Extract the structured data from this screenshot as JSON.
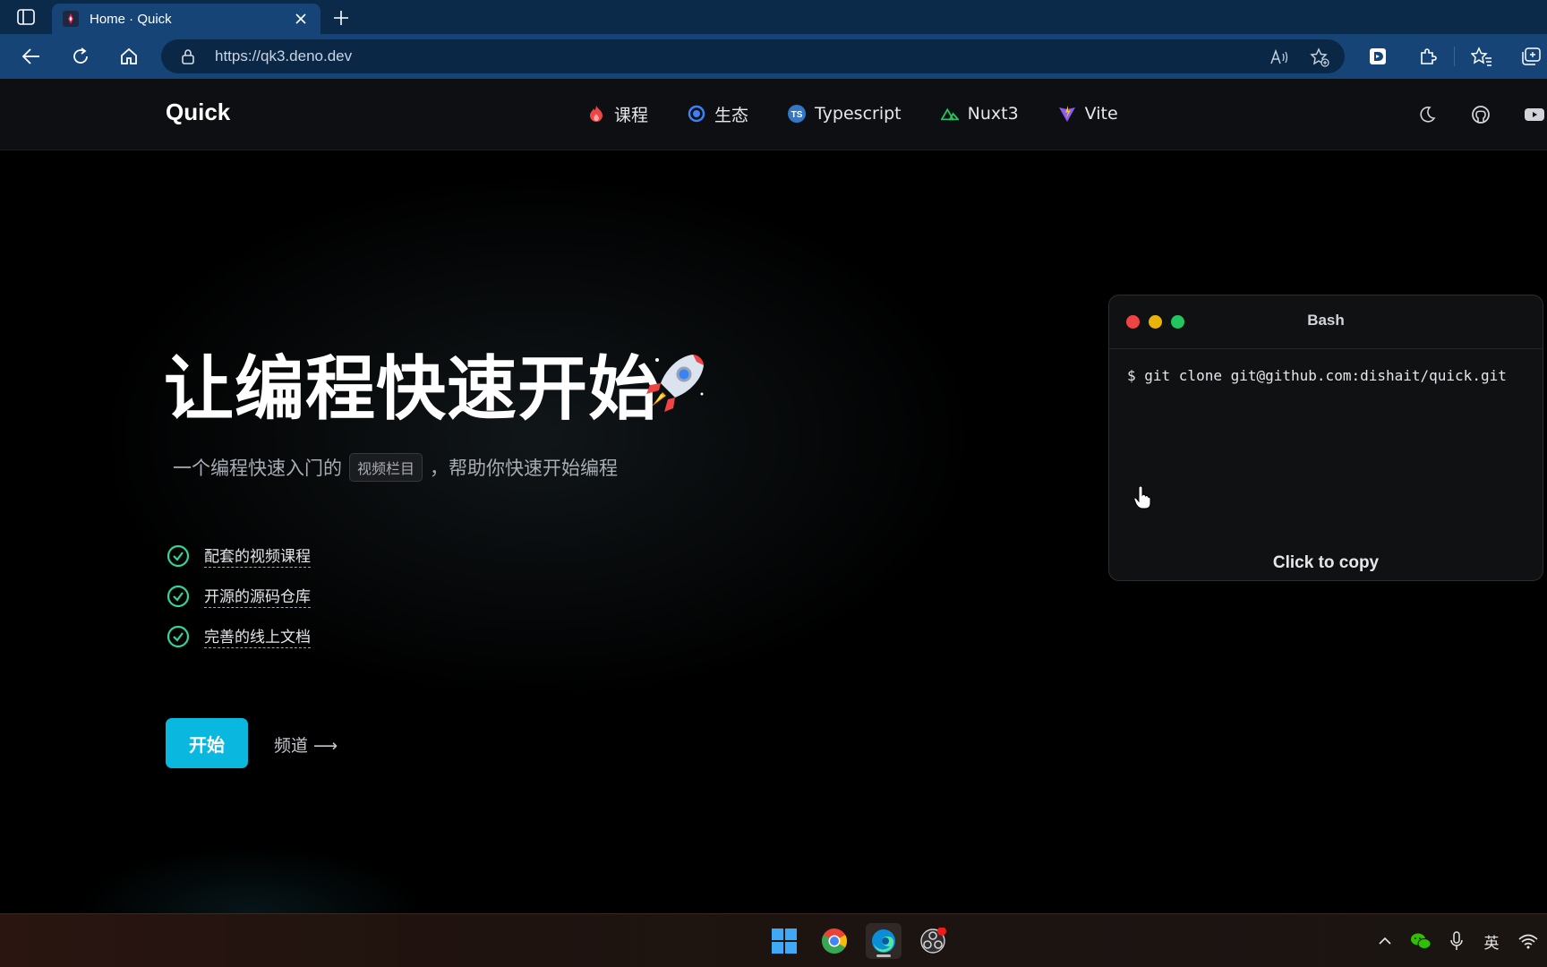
{
  "browser": {
    "tab_title": "Home · Quick",
    "url": "https://qk3.deno.dev"
  },
  "site": {
    "logo": "Quick",
    "nav": [
      {
        "label": "课程",
        "icon": "fire-icon"
      },
      {
        "label": "生态",
        "icon": "ring-icon"
      },
      {
        "label": "Typescript",
        "icon": "typescript-icon"
      },
      {
        "label": "Nuxt3",
        "icon": "nuxt-icon"
      },
      {
        "label": "Vite",
        "icon": "vite-icon"
      }
    ]
  },
  "hero": {
    "title": "让编程快速开始",
    "subtitle_prefix": "一个编程快速入门的",
    "subtitle_tag": "视频栏目",
    "subtitle_suffix": "，帮助你快速开始编程",
    "features": [
      "配套的视频课程",
      "开源的源码仓库",
      "完善的线上文档"
    ],
    "start_label": "开始",
    "channel_label": "频道 ⟶"
  },
  "bash": {
    "title": "Bash",
    "command": "$ git clone git@github.com:dishait/quick.git",
    "copy_label": "Click to copy"
  },
  "taskbar": {
    "tray_language": "英"
  },
  "colors": {
    "accent": "#0ab8df",
    "check": "#34d399",
    "dot_red": "#ef4444",
    "dot_yellow": "#eab308",
    "dot_green": "#22c55e"
  }
}
